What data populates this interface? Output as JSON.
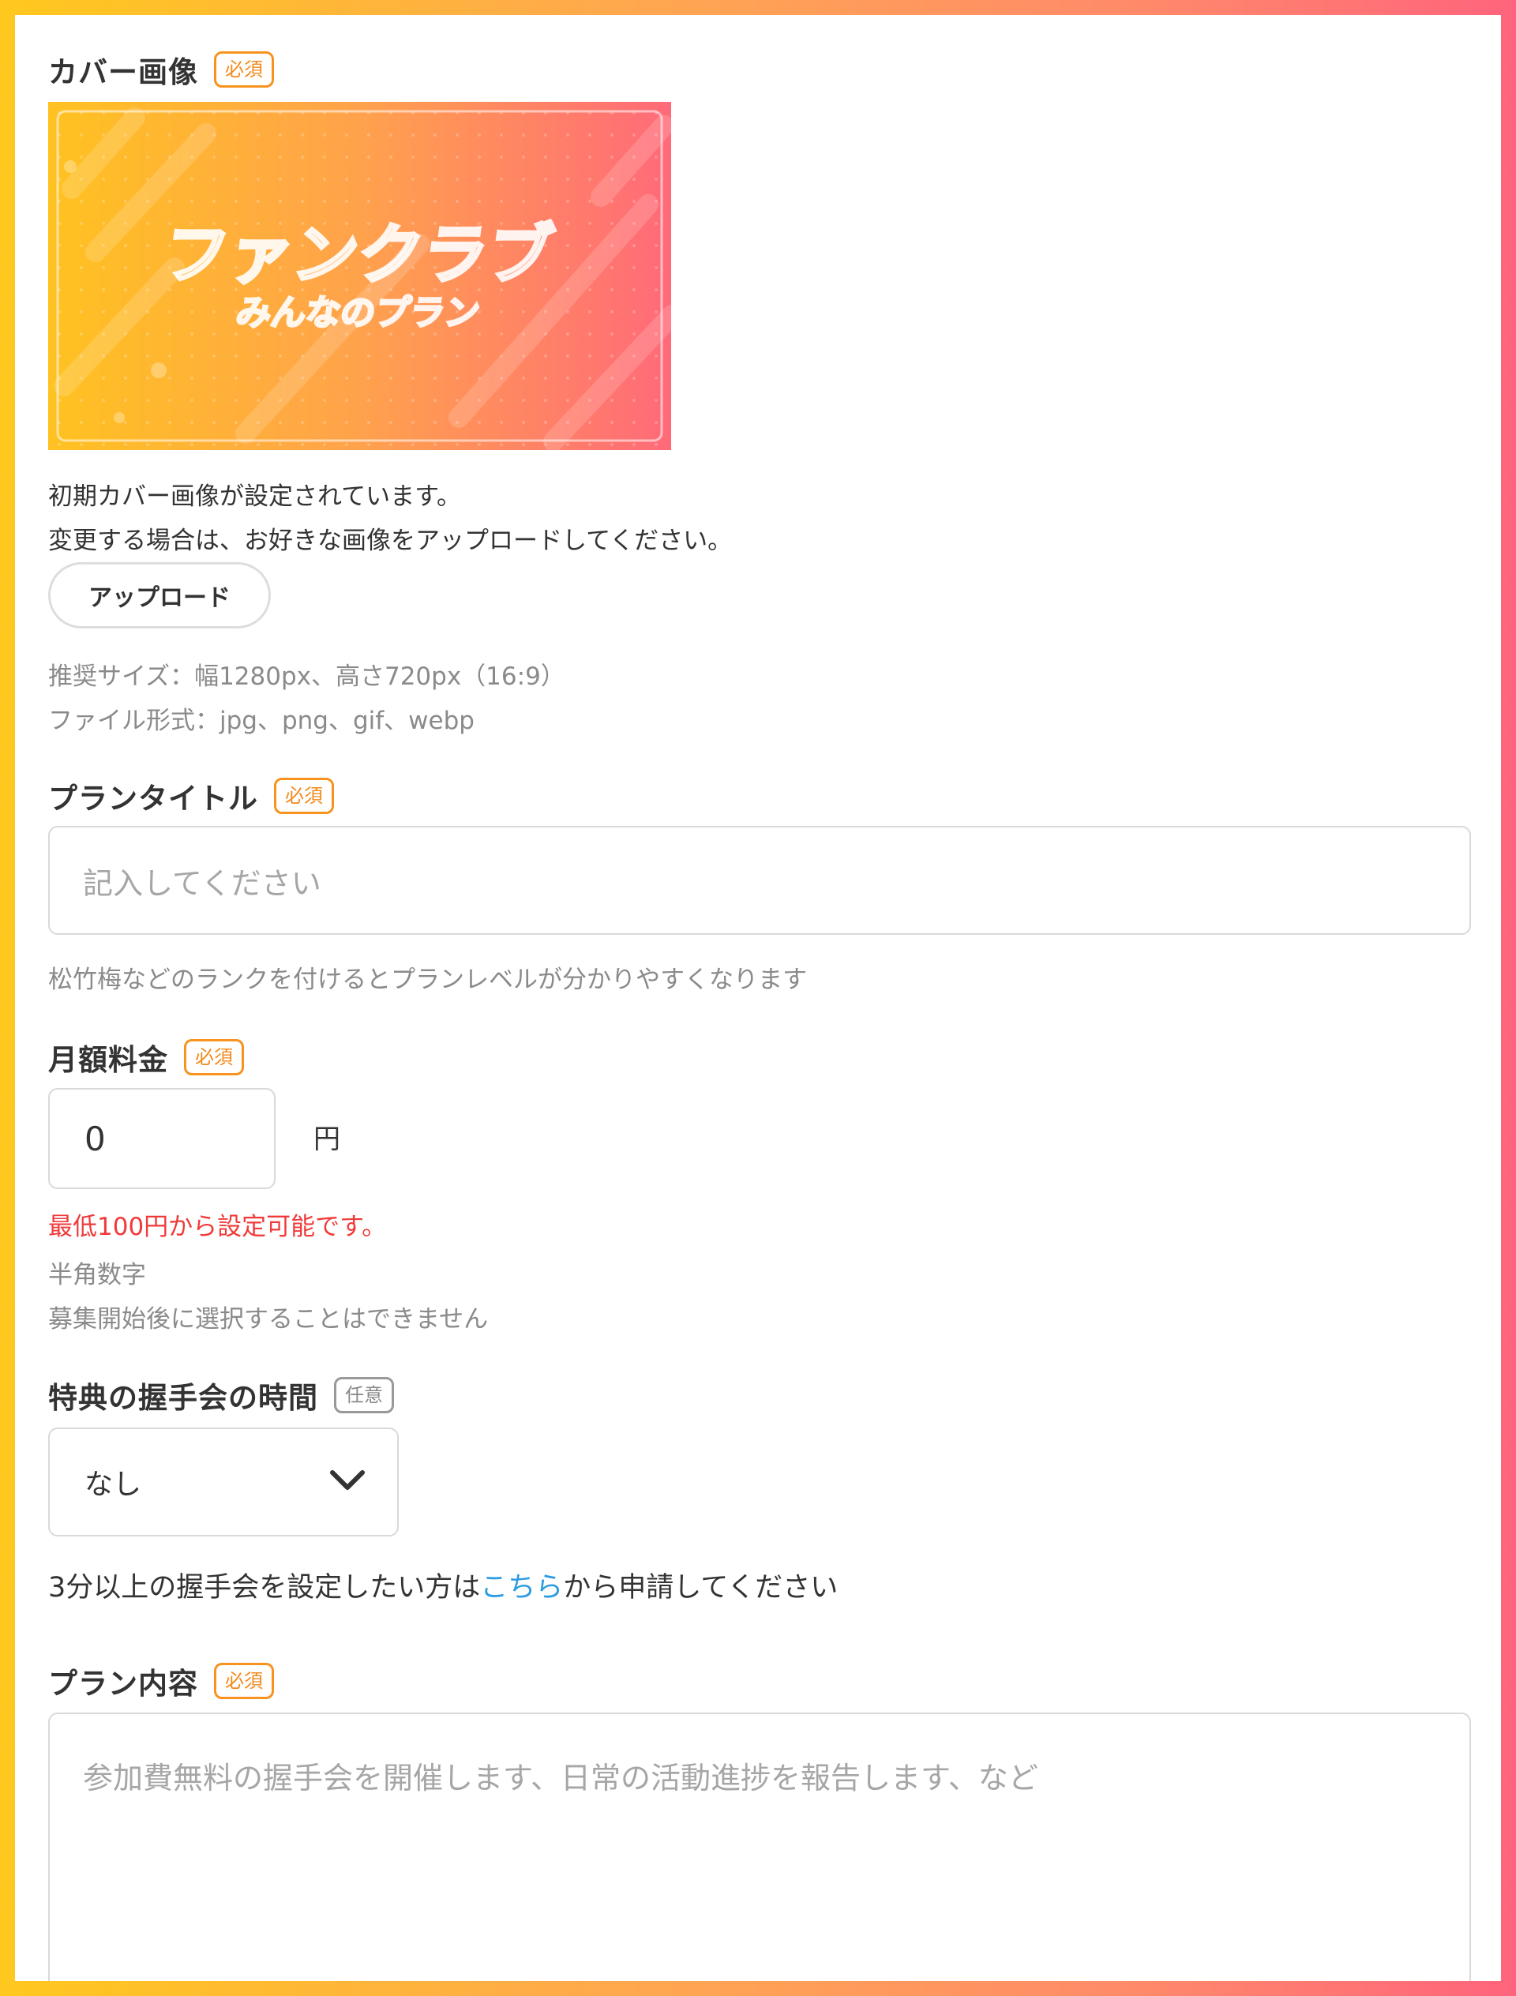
{
  "cover_image": {
    "label": "カバー画像",
    "badge": "必須",
    "image_title": "ファンクラブ",
    "image_subtitle": "みんなのプラン",
    "note_line1": "初期カバー画像が設定されています。",
    "note_line2": "変更する場合は、お好きな画像をアップロードしてください。",
    "upload_label": "アップロード",
    "size_hint": "推奨サイズ：幅1280px、高さ720px（16:9）",
    "format_hint": "ファイル形式：jpg、png、gif、webp"
  },
  "plan_title": {
    "label": "プランタイトル",
    "badge": "必須",
    "placeholder": "記入してください",
    "hint": "松竹梅などのランクを付けるとプランレベルが分かりやすくなります"
  },
  "monthly_fee": {
    "label": "月額料金",
    "badge": "必須",
    "value": "0",
    "unit": "円",
    "error": "最低100円から設定可能です。",
    "hint1": "半角数字",
    "hint2": "募集開始後に選択することはできません"
  },
  "handshake_time": {
    "label": "特典の握手会の時間",
    "badge": "任意",
    "selected": "なし",
    "note_before": "3分以上の握手会を設定したい方は",
    "note_link": "こちら",
    "note_after": "から申請してください"
  },
  "plan_content": {
    "label": "プラン内容",
    "badge": "必須",
    "placeholder": "参加費無料の握手会を開催します、日常の活動進捗を報告します、など"
  },
  "colors": {
    "required_badge": "#f7931e",
    "optional_badge": "#999999",
    "error": "#f03a3a",
    "link": "#2d9ce0",
    "frame_start": "#ffc81e",
    "frame_end": "#ff647c"
  }
}
